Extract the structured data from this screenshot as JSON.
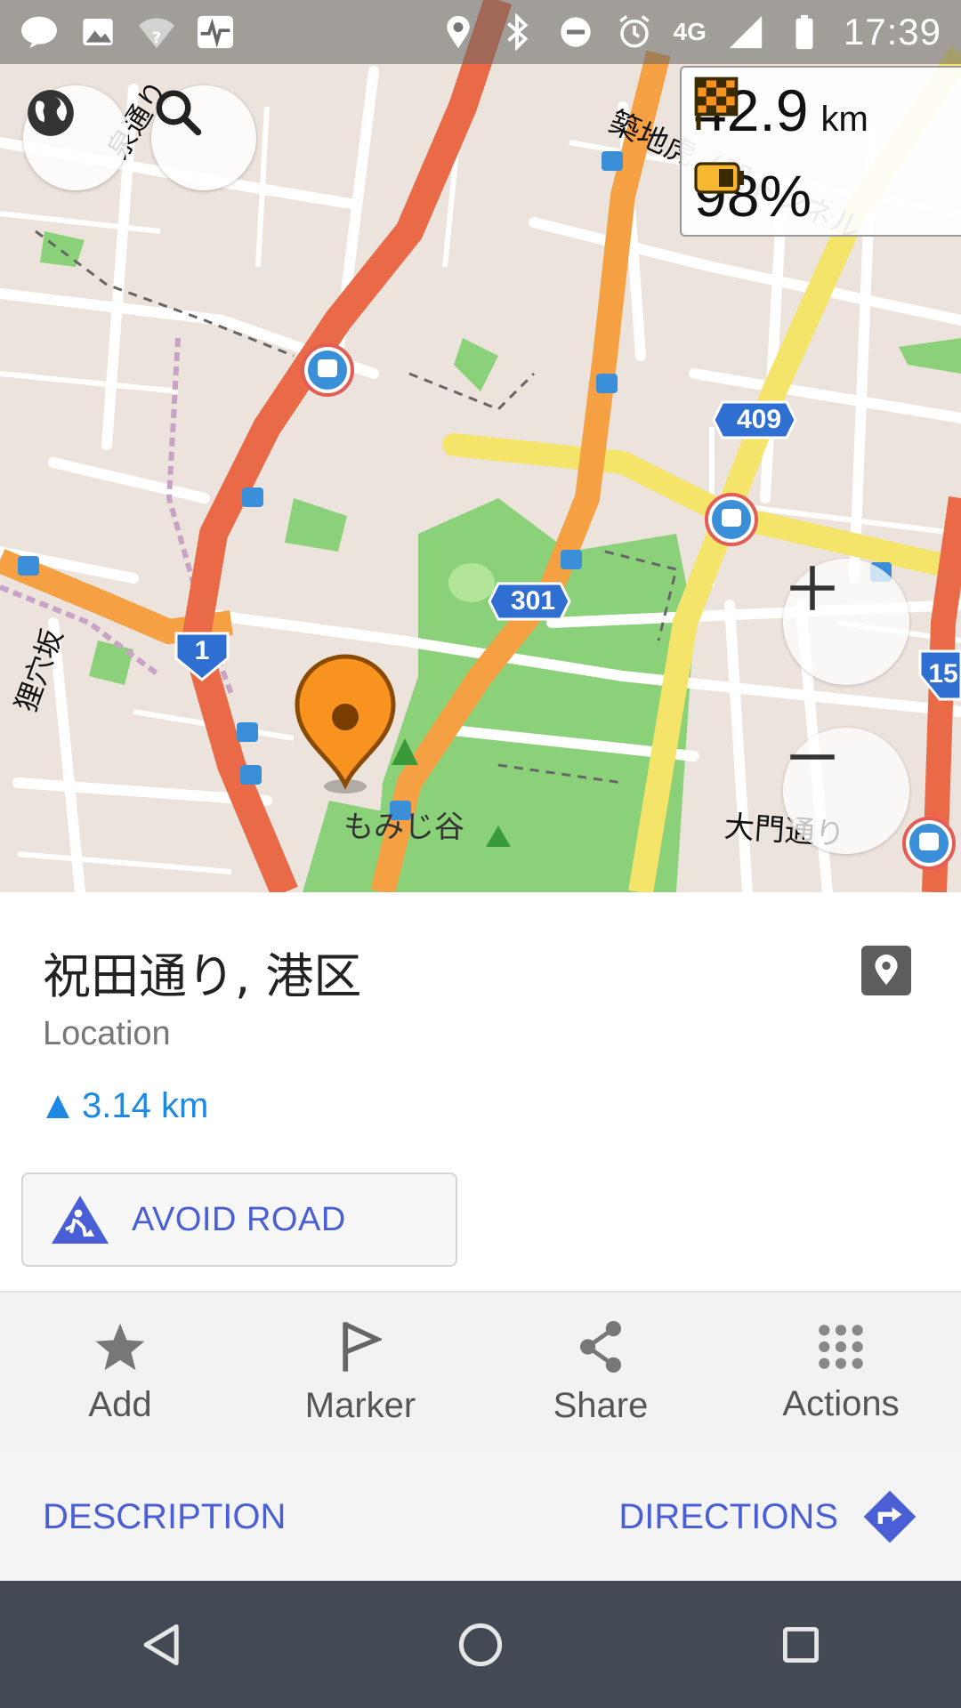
{
  "status_bar": {
    "time": "17:39",
    "network": "4G",
    "left_icons": [
      "line-app-icon",
      "gallery-icon",
      "wifi-unknown-icon",
      "activity-icon"
    ],
    "right_icons": [
      "location-icon",
      "bluetooth-icon",
      "dnd-icon",
      "alarm-icon",
      "signal-icon",
      "battery-icon"
    ]
  },
  "map": {
    "labels": {
      "route_301": "301",
      "route_409": "409",
      "route_1": "1",
      "route_15": "15",
      "park_name": "もみじ谷",
      "street_daimon": "大門通り",
      "street_izumi": "泉通り",
      "street_tsukiji": "築地虎ノ門トンネル",
      "street_saka": "狸穴坂"
    }
  },
  "info_widget": {
    "distance_value": "42.9",
    "distance_unit": "km",
    "battery_value": "98%"
  },
  "place": {
    "title": "祝田通り, 港区",
    "type": "Location",
    "distance": "3.14 km"
  },
  "buttons": {
    "avoid_road": "AVOID ROAD",
    "description": "DESCRIPTION",
    "directions": "DIRECTIONS"
  },
  "actions": [
    {
      "label": "Add",
      "icon": "star-icon"
    },
    {
      "label": "Marker",
      "icon": "flag-icon"
    },
    {
      "label": "Share",
      "icon": "share-icon"
    },
    {
      "label": "Actions",
      "icon": "grid-dots-icon"
    }
  ],
  "colors": {
    "accent": "#4a5fd6",
    "distance_blue": "#1e88e5",
    "marker_orange": "#f7931e",
    "road_red": "#ea6a47",
    "road_orange": "#f4a043",
    "road_yellow": "#f4e56a",
    "park_green": "#8bd17a"
  }
}
